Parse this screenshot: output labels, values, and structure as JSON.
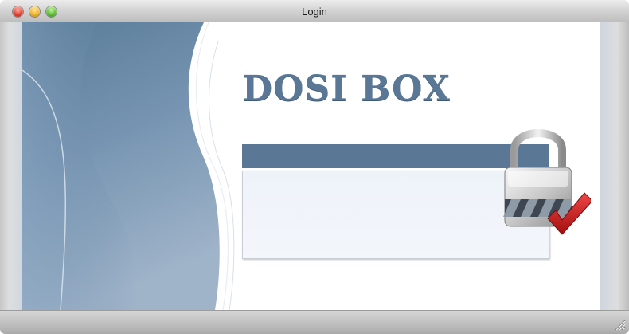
{
  "window": {
    "title": "Login",
    "controls": {
      "close": "close-button",
      "minimize": "minimize-button",
      "zoom": "zoom-button"
    }
  },
  "brand": {
    "name": "DOSI BOX"
  },
  "colors": {
    "accent": "#5a7896",
    "panel_body": "#eef3fa",
    "checkmark": "#d42828"
  },
  "icons": {
    "lock": "padlock-check-icon",
    "resize": "resize-grip-icon"
  }
}
